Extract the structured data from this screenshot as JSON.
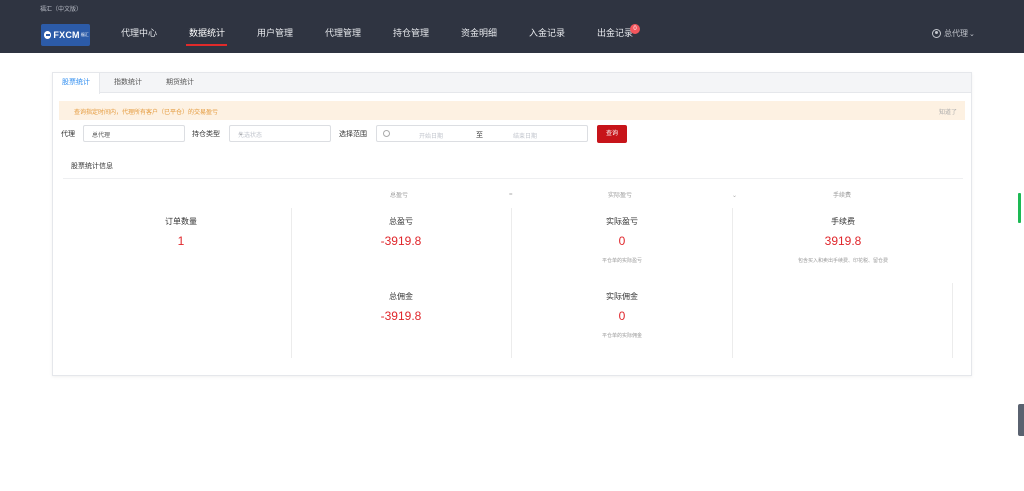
{
  "app": {
    "tiny_title": "福汇（中文版）",
    "logo_text": "FXCM",
    "logo_sub": "福汇"
  },
  "nav": [
    {
      "label": "代理中心"
    },
    {
      "label": "数据统计"
    },
    {
      "label": "用户管理"
    },
    {
      "label": "代理管理"
    },
    {
      "label": "持仓管理"
    },
    {
      "label": "资金明细"
    },
    {
      "label": "入金记录"
    },
    {
      "label": "出金记录"
    }
  ],
  "nav_badge": "0",
  "user": {
    "name": "总代理"
  },
  "tabs": [
    {
      "label": "股票统计",
      "active": true
    },
    {
      "label": "指数统计"
    },
    {
      "label": "期货统计"
    }
  ],
  "notice": {
    "text": "查询指定时间内，代理所有客户（已平仓）的交易盈亏",
    "close": "知道了"
  },
  "filters": {
    "agent_label": "代理",
    "agent_value": "总代理",
    "position_label": "持仓类型",
    "position_placeholder": "先选状态",
    "range_label": "选择范围",
    "start_placeholder": "开始日期",
    "sep": "至",
    "end_placeholder": "结束日期",
    "query_button": "查询"
  },
  "section_title": "股票统计信息",
  "column_heads": [
    "总盈亏",
    "实际盈亏",
    "手续费"
  ],
  "stats": {
    "orders": {
      "label": "订单数量",
      "value": "1"
    },
    "total_pnl": {
      "label": "总盈亏",
      "value": "-3919.8"
    },
    "actual_pnl": {
      "label": "实际盈亏",
      "value": "0",
      "sub": "平仓单的实际盈亏"
    },
    "fee": {
      "label": "手续费",
      "value": "3919.8",
      "sub": "包含买入和卖出手续费、印花税、留仓费"
    },
    "total_commission": {
      "label": "总佣金",
      "value": "-3919.8"
    },
    "actual_commission": {
      "label": "实际佣金",
      "value": "0",
      "sub": "平仓单的实际佣金"
    }
  },
  "colors": {
    "topbar": "#2f3441",
    "accent_red": "#c7141a",
    "value_red": "#e0262b",
    "tab_blue": "#2d8cf0"
  }
}
